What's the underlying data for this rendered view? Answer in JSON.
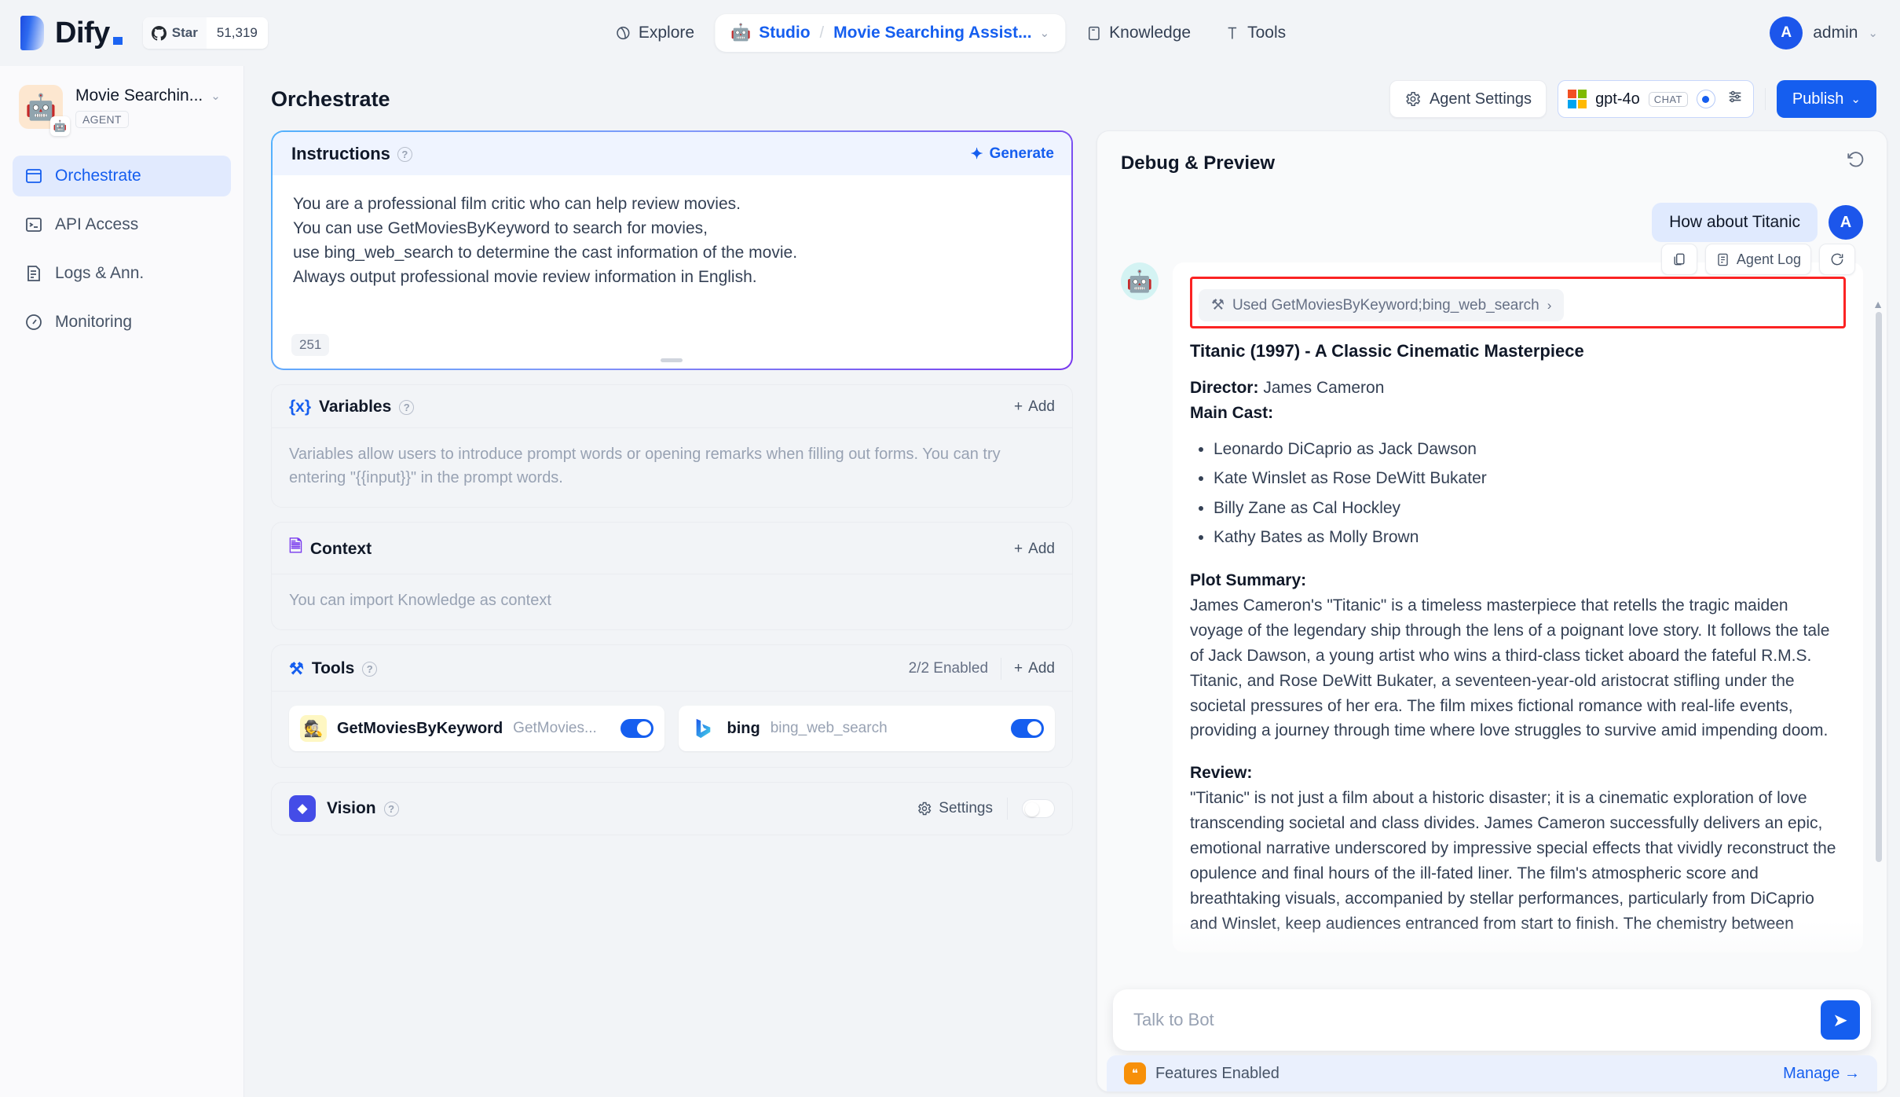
{
  "header": {
    "logo_text": "Dify",
    "star_label": "Star",
    "star_count": "51,319",
    "nav": {
      "explore": "Explore",
      "studio": "Studio",
      "separator": "/",
      "app_name": "Movie Searching Assist...",
      "knowledge": "Knowledge",
      "tools": "Tools"
    },
    "user": {
      "initial": "A",
      "name": "admin"
    }
  },
  "sidebar": {
    "app_title": "Movie Searchin...",
    "app_tag": "AGENT",
    "app_emoji": "🤖",
    "app_badge_emoji": "🤖",
    "items": [
      {
        "label": "Orchestrate",
        "icon": "🗔"
      },
      {
        "label": "API Access",
        "icon": "⌗"
      },
      {
        "label": "Logs & Ann.",
        "icon": "▤"
      },
      {
        "label": "Monitoring",
        "icon": "◎"
      }
    ]
  },
  "main_header": {
    "title": "Orchestrate",
    "agent_settings": "Agent Settings",
    "model_name": "gpt-4o",
    "model_badge": "CHAT",
    "publish": "Publish"
  },
  "instructions": {
    "title": "Instructions",
    "generate": "Generate",
    "lines": [
      "You are a professional film critic who can help review movies.",
      "You can use GetMoviesByKeyword  to search for movies,",
      "use bing_web_search to determine the cast information of the movie.",
      "Always output professional movie review information in English."
    ],
    "char_count": "251"
  },
  "variables": {
    "title": "Variables",
    "add": "Add",
    "hint": "Variables allow users to introduce prompt words or opening remarks when filling out forms. You can try entering \"{{input}}\" in the prompt words."
  },
  "context": {
    "title": "Context",
    "add": "Add",
    "hint": "You can import Knowledge as context"
  },
  "tools": {
    "title": "Tools",
    "enabled": "2/2 Enabled",
    "add": "Add",
    "items": [
      {
        "name": "GetMoviesByKeyword",
        "sub": "GetMovies...",
        "emoji": "🕵️",
        "enabled": true
      },
      {
        "name": "bing",
        "sub": "bing_web_search",
        "emoji": "b",
        "enabled": true
      }
    ]
  },
  "vision": {
    "title": "Vision",
    "settings": "Settings",
    "enabled": false
  },
  "debug": {
    "title": "Debug & Preview",
    "user_message": "How about Titanic",
    "user_initial": "A",
    "bot_emoji": "🤖",
    "copy_icon": "copy-icon",
    "agent_log": "Agent Log",
    "used_tools": "Used GetMoviesByKeyword;bing_web_search",
    "response": {
      "heading": "Titanic (1997) - A Classic Cinematic Masterpiece",
      "director_label": "Director:",
      "director_name": " James Cameron",
      "cast_label": "Main Cast:",
      "cast": [
        "Leonardo DiCaprio as Jack Dawson",
        "Kate Winslet as Rose DeWitt Bukater",
        "Billy Zane as Cal Hockley",
        "Kathy Bates as Molly Brown"
      ],
      "plot_label": "Plot Summary:",
      "plot_text": "James Cameron's \"Titanic\" is a timeless masterpiece that retells the tragic maiden voyage of the legendary ship through the lens of a poignant love story. It follows the tale of Jack Dawson, a young artist who wins a third-class ticket aboard the fateful R.M.S. Titanic, and Rose DeWitt Bukater, a seventeen-year-old aristocrat stifling under the societal pressures of her era. The film mixes fictional romance with real-life events, providing a journey through time where love struggles to survive amid impending doom.",
      "review_label": "Review:",
      "review_text": "\"Titanic\" is not just a film about a historic disaster; it is a cinematic exploration of love transcending societal and class divides. James Cameron successfully delivers an epic, emotional narrative underscored by impressive special effects that vividly reconstruct the opulence and final hours of the ill-fated liner. The film's atmospheric score and breathtaking visuals, accompanied by stellar performances, particularly from DiCaprio and Winslet, keep audiences entranced from start to finish. The chemistry between"
    },
    "input_placeholder": "Talk to Bot",
    "features_label": "Features Enabled",
    "manage_label": "Manage →"
  },
  "colors": {
    "accent": "#155EEF",
    "highlight_box": "#FB2323",
    "panel_bg": "#F2F4F7"
  }
}
